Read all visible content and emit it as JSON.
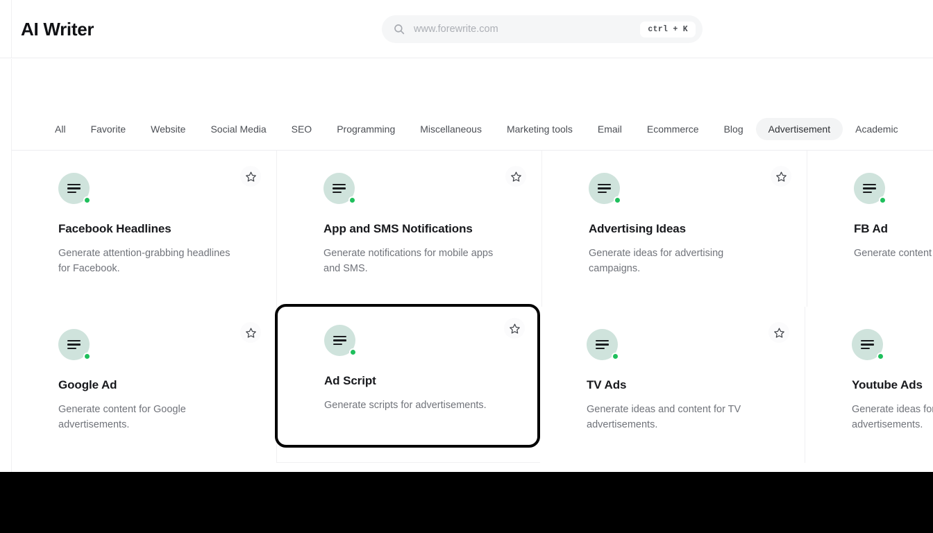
{
  "header": {
    "brand": "AI Writer",
    "search": {
      "placeholder": "www.forewrite.com",
      "value": "",
      "shortcut": "ctrl + K",
      "icon": "search-icon"
    }
  },
  "nav": {
    "active": "Advertisement",
    "tabs": [
      {
        "label": "All",
        "active": false
      },
      {
        "label": "Favorite",
        "active": false
      },
      {
        "label": "Website",
        "active": false
      },
      {
        "label": "Social Media",
        "active": false
      },
      {
        "label": "SEO",
        "active": false
      },
      {
        "label": "Programming",
        "active": false
      },
      {
        "label": "Miscellaneous",
        "active": false
      },
      {
        "label": "Marketing tools",
        "active": false
      },
      {
        "label": "Email",
        "active": false
      },
      {
        "label": "Ecommerce",
        "active": false
      },
      {
        "label": "Blog",
        "active": false
      },
      {
        "label": "Advertisement",
        "active": true
      },
      {
        "label": "Academic",
        "active": false
      }
    ]
  },
  "grid": {
    "rows": [
      {
        "cards": [
          {
            "title": "Facebook Headlines",
            "desc": "Generate attention-grabbing headlines for Facebook.",
            "favorite": false,
            "highlighted": false,
            "icon": "document-lines-icon",
            "status": "online"
          },
          {
            "title": "App and SMS Notifications",
            "desc": "Generate notifications for mobile apps and SMS.",
            "favorite": false,
            "highlighted": false,
            "icon": "document-lines-icon",
            "status": "online"
          },
          {
            "title": "Advertising Ideas",
            "desc": "Generate ideas for advertising campaigns.",
            "favorite": false,
            "highlighted": false,
            "icon": "document-lines-icon",
            "status": "online"
          },
          {
            "title": "FB Ad",
            "desc": "Generate content for advertisements.",
            "favorite": false,
            "highlighted": false,
            "icon": "document-lines-icon",
            "status": "online"
          }
        ]
      },
      {
        "cards": [
          {
            "title": "Google Ad",
            "desc": "Generate content for Google advertisements.",
            "favorite": false,
            "highlighted": false,
            "icon": "document-lines-icon",
            "status": "online"
          },
          {
            "title": "Ad Script",
            "desc": "Generate scripts for advertisements.",
            "favorite": false,
            "highlighted": true,
            "icon": "document-lines-icon",
            "status": "online"
          },
          {
            "title": "TV Ads",
            "desc": "Generate ideas and content for TV advertisements.",
            "favorite": false,
            "highlighted": false,
            "icon": "document-lines-icon",
            "status": "online"
          },
          {
            "title": "Youtube Ads",
            "desc": "Generate ideas for YouTube advertisements.",
            "favorite": false,
            "highlighted": false,
            "icon": "document-lines-icon",
            "status": "online"
          }
        ]
      }
    ]
  },
  "colors": {
    "icon_bg": "#cfe3dc",
    "status_dot": "#1fbf5c",
    "active_tab_bg": "#f3f4f5",
    "highlight_border": "#000000",
    "bottom_bar": "#000000"
  }
}
